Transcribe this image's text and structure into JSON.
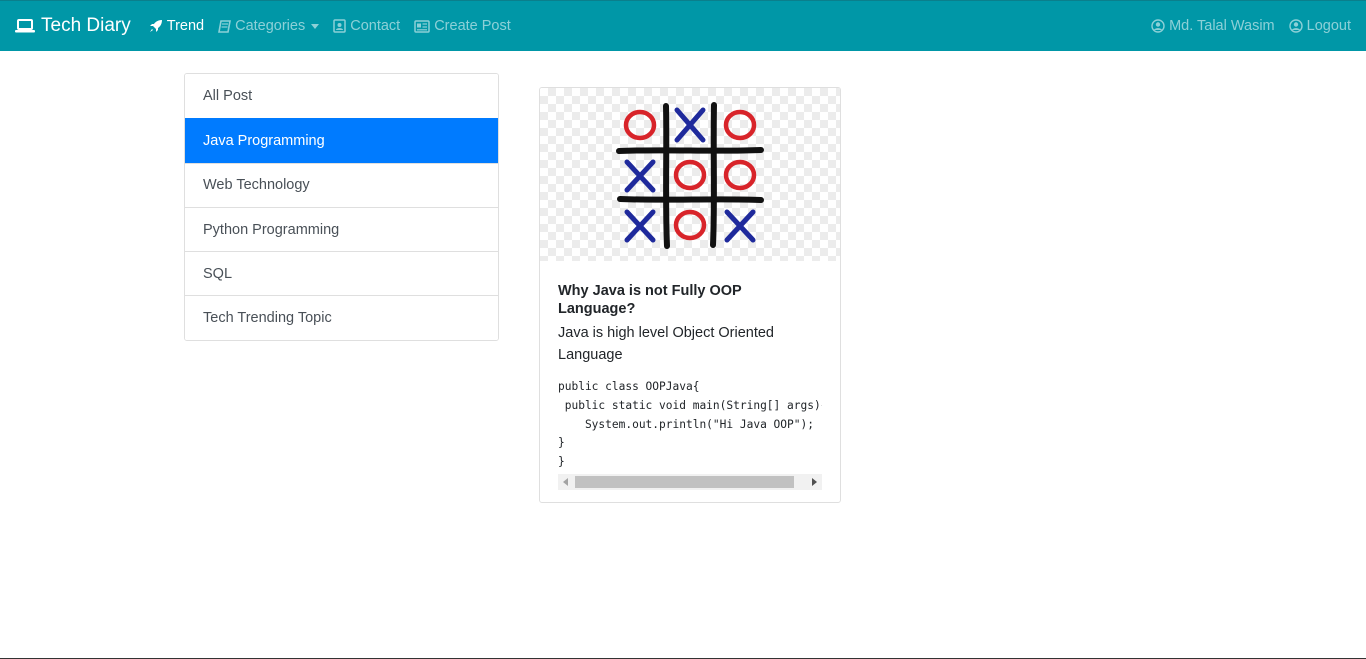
{
  "navbar": {
    "brand": "Tech Diary",
    "items": [
      {
        "label": "Trend",
        "icon": "rocket-icon"
      },
      {
        "label": "Categories",
        "icon": "book-icon"
      },
      {
        "label": "Contact",
        "icon": "contact-book-icon"
      },
      {
        "label": "Create Post",
        "icon": "news-icon"
      }
    ],
    "user": {
      "label": "Md. Talal Wasim",
      "icon": "user-circle-icon"
    },
    "logout": {
      "label": "Logout",
      "icon": "user-circle-icon"
    },
    "colors": {
      "bar": "#0097a7",
      "active_category": "#007bff"
    }
  },
  "categories": [
    {
      "label": "All Post",
      "active": false
    },
    {
      "label": "Java Programming",
      "active": true
    },
    {
      "label": "Web Technology",
      "active": false
    },
    {
      "label": "Python Programming",
      "active": false
    },
    {
      "label": "SQL",
      "active": false
    },
    {
      "label": "Tech Trending Topic",
      "active": false
    }
  ],
  "post": {
    "image": "tic-tac-toe-board",
    "title": "Why Java is not Fully OOP Language?",
    "description": "Java is high level Object Oriented Language",
    "code": "public class OOPJava{\n public static void main(String[] args){\n    System.out.println(\"Hi Java OOP\");\n}\n}"
  }
}
